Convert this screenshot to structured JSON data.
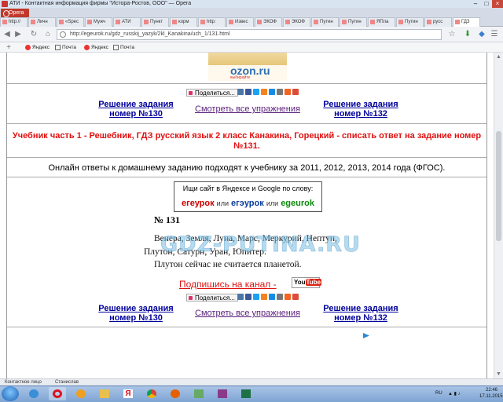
{
  "window": {
    "title": "АТИ - Контактная информация фирмы \"Истоpa-Ростов, ООО\" — Opera"
  },
  "browser": {
    "menu_label": "Opera",
    "tabs": [
      {
        "label": "http://"
      },
      {
        "label": "Личн"
      },
      {
        "label": "«Spec"
      },
      {
        "label": "Мужч"
      },
      {
        "label": "АТИ"
      },
      {
        "label": "Пункт"
      },
      {
        "label": "корм"
      },
      {
        "label": "http:"
      },
      {
        "label": "Извес"
      },
      {
        "label": "ЭКОФ"
      },
      {
        "label": "ЭКОФ"
      },
      {
        "label": "Путин"
      },
      {
        "label": "Путин"
      },
      {
        "label": "ЯПла"
      },
      {
        "label": "Путин"
      },
      {
        "label": "русс"
      },
      {
        "label": "ГДЗ"
      }
    ],
    "url": "http://egeurok.ru/gdz_russkij_yazyk/2kl_Kanakina/uch_1/131.html",
    "bookmarks": [
      "Яндекс",
      "Почта",
      "Яндекс",
      "Почта"
    ]
  },
  "page": {
    "ozon": {
      "logo": "ozon.ru",
      "tagline": "выбирайте"
    },
    "share_label": "Поделиться...",
    "nav_top": {
      "prev": "Решение задания номер №130",
      "all": "Смотреть все упражнения",
      "next": "Решение задания номер №132"
    },
    "nav_bottom": {
      "prev": "Решение задания номер №130",
      "all": "Смотреть все упражнения",
      "next": "Решение задания номер №132"
    },
    "title": "Учебник часть 1 - Решебник, ГДЗ русский язык 2 класс Канакина, Горецкий - списать ответ на задание номер №131.",
    "answers_note": "Онлайн ответы к домашнему заданию подходят к учебнику за 2011, 2012, 2013, 2014 года (ФГОС).",
    "search_box": {
      "label": "Ищи сайт в Яндексе и Google по слову:",
      "word1": "егеурок",
      "or1": "или",
      "word2": "егэурок",
      "or2": "или",
      "word3": "egeurok"
    },
    "task": {
      "number": "№ 131",
      "lines": [
        "Венера, Земля, Луна, Марс, Меркурий, Нептун,",
        "Плутон, Сатурн, Уран, Юпитер.",
        "Плутон сейчас не считается планетой."
      ],
      "watermark": "GDZ-PUTINA.RU"
    },
    "subscribe": "Подпишись на канал -",
    "youtube": {
      "you": "You",
      "tube": "Tube"
    }
  },
  "statusbar": {
    "items": [
      "Контактное лицо",
      "Станислав"
    ]
  },
  "taskbar": {
    "lang": "RU",
    "time": "22:46",
    "date": "17.11.2015"
  }
}
